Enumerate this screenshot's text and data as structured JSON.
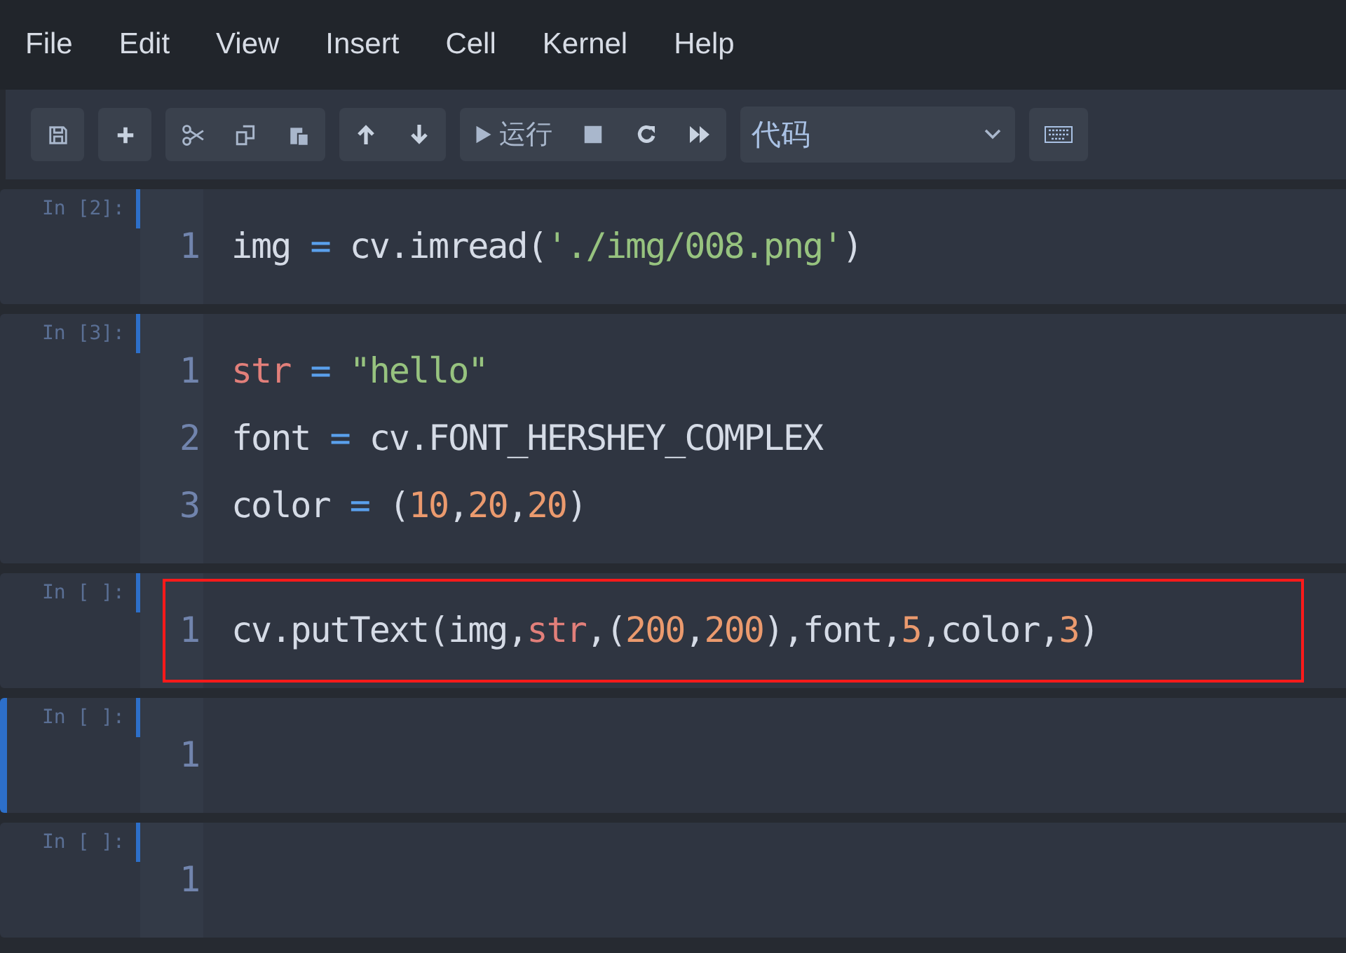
{
  "menu": [
    {
      "label": "File"
    },
    {
      "label": "Edit"
    },
    {
      "label": "View"
    },
    {
      "label": "Insert"
    },
    {
      "label": "Cell"
    },
    {
      "label": "Kernel"
    },
    {
      "label": "Help"
    }
  ],
  "toolbar": {
    "run_label": "运行",
    "cell_type": "代码"
  },
  "cells": [
    {
      "prompt": "In [2]:",
      "selected": false,
      "highlighted": false,
      "lines": [
        {
          "number": "1",
          "tokens": [
            {
              "kind": "plain",
              "text": "img"
            },
            {
              "kind": "op",
              "text": " = "
            },
            {
              "kind": "plain",
              "text": "cv.imread("
            },
            {
              "kind": "string",
              "text": "'./img/008.png'"
            },
            {
              "kind": "plain",
              "text": ")"
            }
          ]
        }
      ]
    },
    {
      "prompt": "In [3]:",
      "selected": false,
      "highlighted": false,
      "lines": [
        {
          "number": "1",
          "tokens": [
            {
              "kind": "var",
              "text": "str"
            },
            {
              "kind": "op",
              "text": " = "
            },
            {
              "kind": "string",
              "text": "\"hello\""
            }
          ]
        },
        {
          "number": "2",
          "tokens": [
            {
              "kind": "plain",
              "text": "font"
            },
            {
              "kind": "op",
              "text": " = "
            },
            {
              "kind": "plain",
              "text": "cv.FONT_HERSHEY_COMPLEX"
            }
          ]
        },
        {
          "number": "3",
          "tokens": [
            {
              "kind": "plain",
              "text": "color"
            },
            {
              "kind": "op",
              "text": " = "
            },
            {
              "kind": "plain",
              "text": "("
            },
            {
              "kind": "number",
              "text": "10"
            },
            {
              "kind": "plain",
              "text": ","
            },
            {
              "kind": "number",
              "text": "20"
            },
            {
              "kind": "plain",
              "text": ","
            },
            {
              "kind": "number",
              "text": "20"
            },
            {
              "kind": "plain",
              "text": ")"
            }
          ]
        }
      ]
    },
    {
      "prompt": "In [ ]:",
      "selected": false,
      "highlighted": true,
      "lines": [
        {
          "number": "1",
          "tokens": [
            {
              "kind": "plain",
              "text": "cv.putText(img,"
            },
            {
              "kind": "var",
              "text": "str"
            },
            {
              "kind": "plain",
              "text": ",("
            },
            {
              "kind": "number",
              "text": "200"
            },
            {
              "kind": "plain",
              "text": ","
            },
            {
              "kind": "number",
              "text": "200"
            },
            {
              "kind": "plain",
              "text": "),font,"
            },
            {
              "kind": "number",
              "text": "5"
            },
            {
              "kind": "plain",
              "text": ",color,"
            },
            {
              "kind": "number",
              "text": "3"
            },
            {
              "kind": "plain",
              "text": ")"
            }
          ]
        }
      ]
    },
    {
      "prompt": "In [ ]:",
      "selected": true,
      "highlighted": false,
      "lines": [
        {
          "number": "1"
        }
      ]
    },
    {
      "prompt": "In [ ]:",
      "selected": false,
      "highlighted": false,
      "lines": [
        {
          "number": "1"
        }
      ]
    }
  ]
}
